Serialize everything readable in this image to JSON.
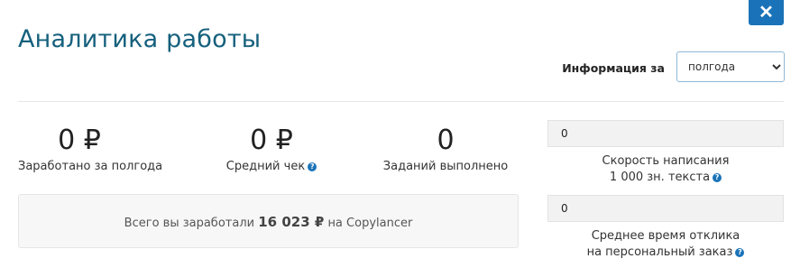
{
  "dialog": {
    "close_symbol": "✕",
    "title": "Аналитика работы"
  },
  "period": {
    "label": "Информация за",
    "selected": "полгода",
    "options": [
      "полгода"
    ]
  },
  "stats": [
    {
      "value": "0 ₽",
      "label": "Заработано за полгода",
      "has_help": false
    },
    {
      "value": "0 ₽",
      "label": "Средний чек",
      "has_help": true
    },
    {
      "value": "0",
      "label": "Заданий выполнено",
      "has_help": false
    }
  ],
  "earnings_box": {
    "prefix": "Всего вы заработали",
    "amount": "16 023 ₽",
    "suffix": "на Copylancer"
  },
  "metrics": [
    {
      "value": "0",
      "caption_line1": "Скорость написания",
      "caption_line2": "1 000 зн. текста"
    },
    {
      "value": "0",
      "caption_line1": "Среднее время отклика",
      "caption_line2": "на персональный заказ"
    }
  ],
  "help_icon_glyph": "?",
  "colors": {
    "accent": "#1a73b8",
    "title": "#15607d"
  }
}
